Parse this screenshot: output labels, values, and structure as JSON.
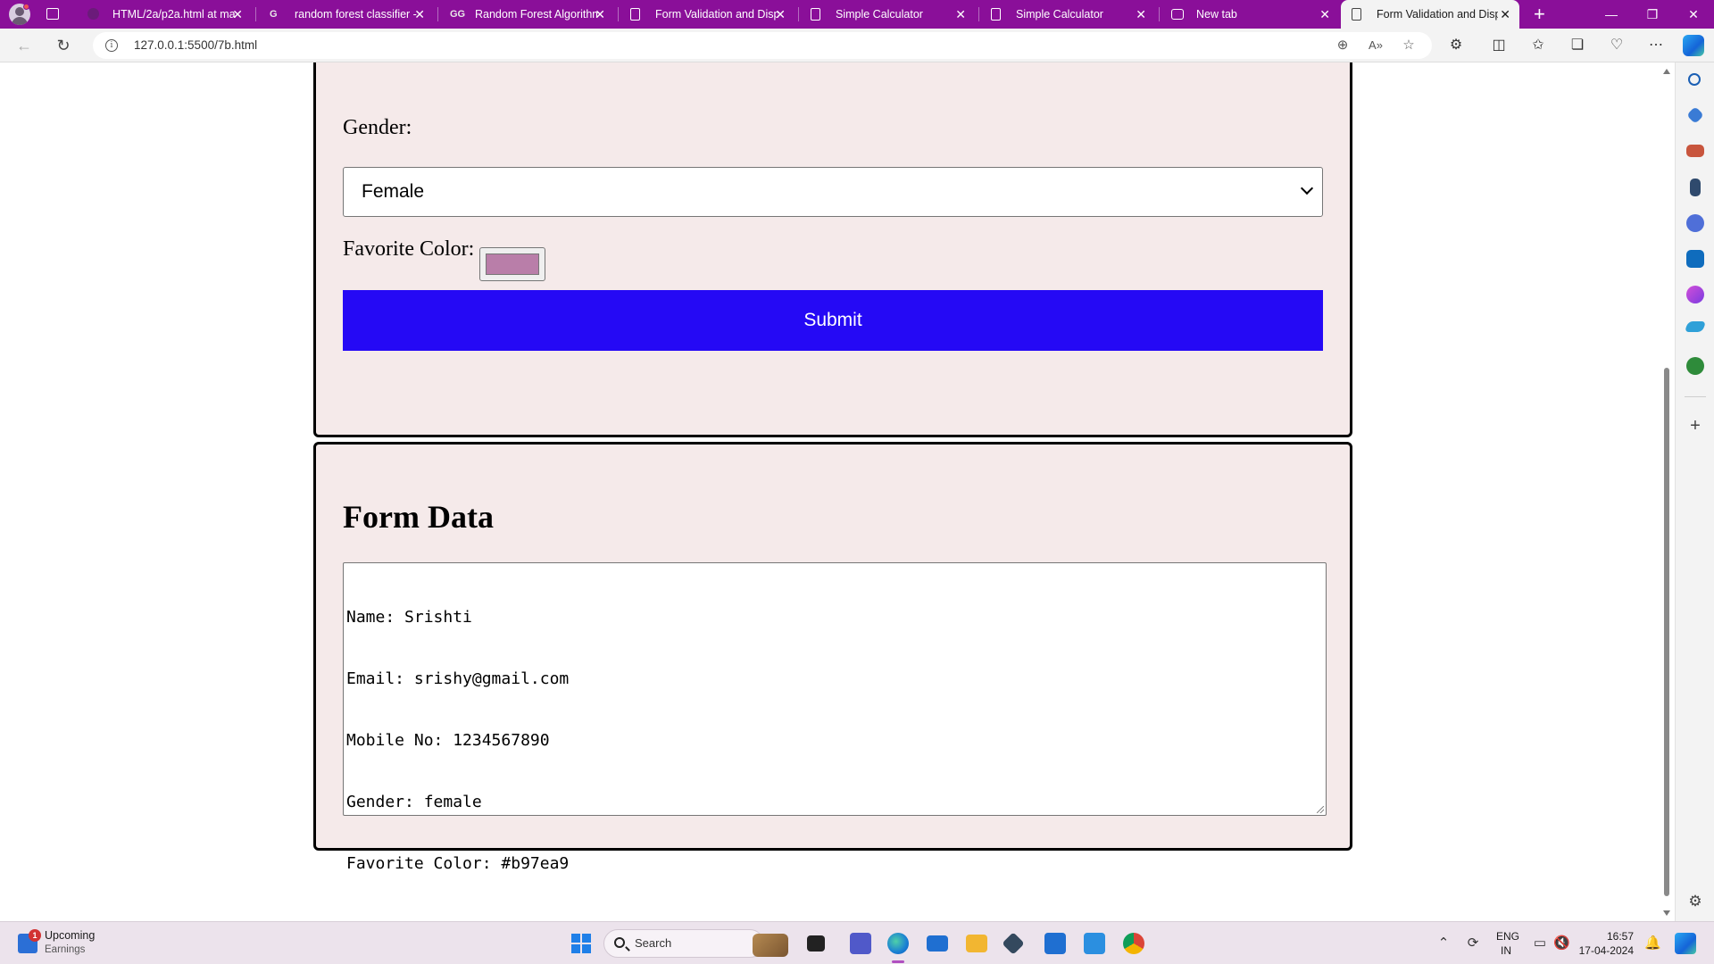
{
  "browser": {
    "tabs": [
      {
        "title": "HTML/2a/p2a.html at mai",
        "favicon": "github-icon"
      },
      {
        "title": "random forest classifier -",
        "favicon": "google-icon"
      },
      {
        "title": "Random Forest Algorithm",
        "favicon": "geeksforgeeks-icon"
      },
      {
        "title": "Form Validation and Displ",
        "favicon": "document-icon"
      },
      {
        "title": "Simple Calculator",
        "favicon": "document-icon"
      },
      {
        "title": "Simple Calculator",
        "favicon": "document-icon"
      },
      {
        "title": "New tab",
        "favicon": "new-tab-icon"
      },
      {
        "title": "Form Validation and Displ",
        "favicon": "document-icon",
        "active": true
      }
    ],
    "url": "127.0.0.1:5500/7b.html",
    "theme_color": "#8a0f99"
  },
  "form": {
    "gender_label": "Gender:",
    "gender_value": "Female",
    "color_label": "Favorite Color:",
    "color_value": "#b97ea9",
    "submit_label": "Submit"
  },
  "form_data": {
    "heading": "Form Data",
    "lines": [
      "Name: Srishti",
      "Email: srishy@gmail.com",
      "Mobile No: 1234567890",
      "Gender: female",
      "Favorite Color: #b97ea9"
    ]
  },
  "taskbar": {
    "widget_title": "Upcoming",
    "widget_subtitle": "Earnings",
    "widget_badge": "1",
    "search_placeholder": "Search",
    "language_line1": "ENG",
    "language_line2": "IN",
    "time": "16:57",
    "date": "17-04-2024"
  },
  "colors": {
    "card_background": "#f5eaea",
    "submit_background": "#2509f5"
  }
}
